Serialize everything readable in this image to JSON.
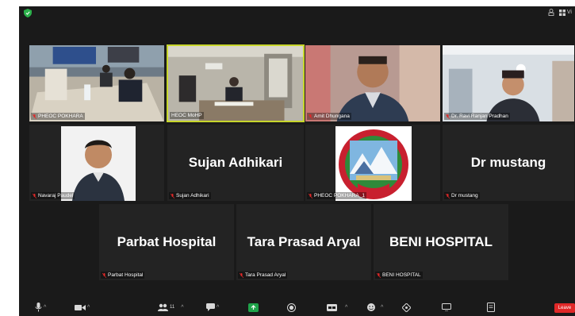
{
  "window": {
    "view_label": "Vi",
    "leave_label": "Leave"
  },
  "tiles": [
    {
      "label": "PHEOC POKHARA"
    },
    {
      "label": "HEOC MoHP"
    },
    {
      "label": "Amit Dhungana"
    },
    {
      "label": "Dr. Ravi Ranjan Pradhan"
    },
    {
      "label": "Navaraj Paudel"
    },
    {
      "label": "Sujan Adhikari",
      "display_name": "Sujan Adhikari"
    },
    {
      "label": "PHEOC POKHARA_1"
    },
    {
      "label": "Dr mustang",
      "display_name": "Dr mustang"
    },
    {
      "label": "Parbat Hospital",
      "display_name": "Parbat Hospital"
    },
    {
      "label": "Tara Prasad Aryal",
      "display_name": "Tara Prasad Aryal"
    },
    {
      "label": "BENI HOSPITAL",
      "display_name": "BENI HOSPITAL"
    }
  ],
  "toolbar": {
    "participants_count": "11",
    "colors": {
      "share_green": "#1fa34a",
      "leave_red": "#e02828",
      "speaker_border": "#c7d62b"
    }
  }
}
